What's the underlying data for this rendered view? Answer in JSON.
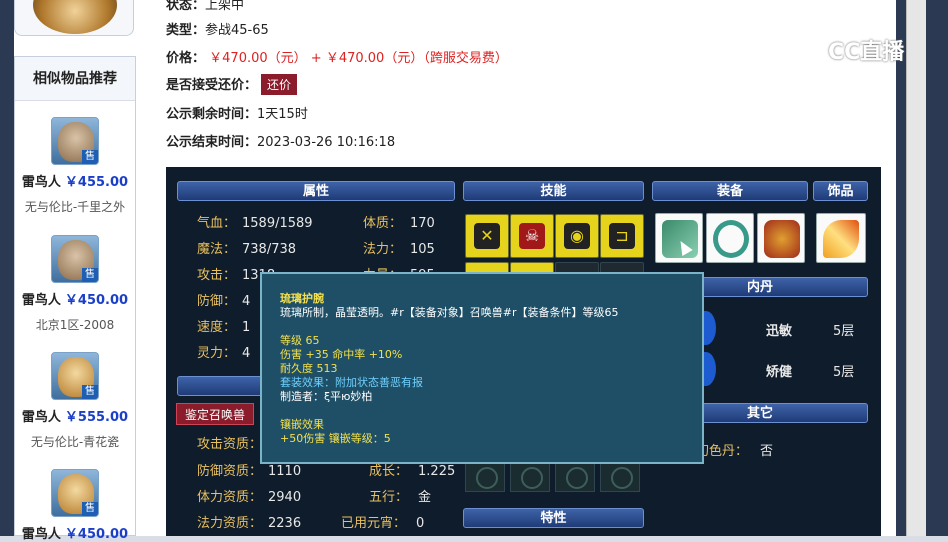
{
  "sidebar": {
    "title": "相似物品推荐",
    "items": [
      {
        "name": "雷鸟人",
        "price": "￥455.00",
        "desc": "无与伦比-千里之外",
        "sell": "售"
      },
      {
        "name": "雷鸟人",
        "price": "￥450.00",
        "desc": "北京1区-2008",
        "sell": "售"
      },
      {
        "name": "雷鸟人",
        "price": "￥555.00",
        "desc": "无与伦比-青花瓷",
        "sell": "售"
      },
      {
        "name": "雷鸟人",
        "price": "￥450.00",
        "desc": "",
        "sell": "售"
      }
    ]
  },
  "info": {
    "status_label": "状态：",
    "status_value": "上架中",
    "type_label": "类型：",
    "type_value": "参战45-65",
    "price_label": "价格：",
    "price_value": "￥470.00（元）",
    "price_plus": "+",
    "price_fee": "￥470.00（元）（跨服交易费）",
    "haggle_label": "是否接受还价：",
    "haggle_button": "还价",
    "remaining_label": "公示剩余时间：",
    "remaining_value": "1天15时",
    "end_label": "公示结束时间：",
    "end_value": "2023-03-26 10:16:18"
  },
  "panel": {
    "headers": {
      "attributes": "属性",
      "skills": "技能",
      "equipment": "装备",
      "accessory": "饰品",
      "neidan": "内丹",
      "other": "其它",
      "traits": "特性"
    },
    "stats_left": [
      {
        "k": "气血：",
        "v": "1589/1589"
      },
      {
        "k": "魔法：",
        "v": "738/738"
      },
      {
        "k": "攻击：",
        "v": "1318"
      },
      {
        "k": "防御：",
        "v": "4"
      },
      {
        "k": "速度：",
        "v": "1"
      },
      {
        "k": "灵力：",
        "v": "4"
      }
    ],
    "stats_right": [
      {
        "k": "体质：",
        "v": "170"
      },
      {
        "k": "法力：",
        "v": "105"
      },
      {
        "k": "力量：",
        "v": "595"
      }
    ],
    "appraise_button": "鉴定召唤兽",
    "aptitude": [
      {
        "k": "攻击资质：",
        "v": ""
      },
      {
        "k": "防御资质：",
        "v": "1110"
      },
      {
        "k": "体力资质：",
        "v": "2940"
      },
      {
        "k": "法力资质：",
        "v": "2236"
      }
    ],
    "aptitude_right": [
      {
        "k": "成长：",
        "v": "1.225"
      },
      {
        "k": "五行：",
        "v": "金"
      },
      {
        "k": "已用元宵：",
        "v": "0"
      }
    ],
    "neidan_list": [
      {
        "name": "迅敏",
        "level": "5层"
      },
      {
        "name": "矫健",
        "level": "5层"
      }
    ],
    "other_label": "幻色丹：",
    "other_value": "否"
  },
  "tooltip": {
    "title": "琉璃护腕",
    "desc": "琉璃所制，晶莹透明。#r【装备对象】召唤兽#r【装备条件】等级65",
    "level": "等级 65",
    "damage": "伤害 +35 命中率 +10%",
    "durability": "耐久度 513",
    "set_effect": "套装效果：附加状态善恶有报",
    "maker": "制造者：ξ平ю妙柏",
    "inlay_title": "镶嵌效果",
    "inlay_detail": "+50伤害 镶嵌等级：5"
  },
  "watermark": {
    "text": "CC直播"
  },
  "colors": {
    "accent_red": "#d22222",
    "panel_bg": "#0f1c2b",
    "header_blue": "#2e4f95",
    "price_blue": "#1c3fc8"
  }
}
